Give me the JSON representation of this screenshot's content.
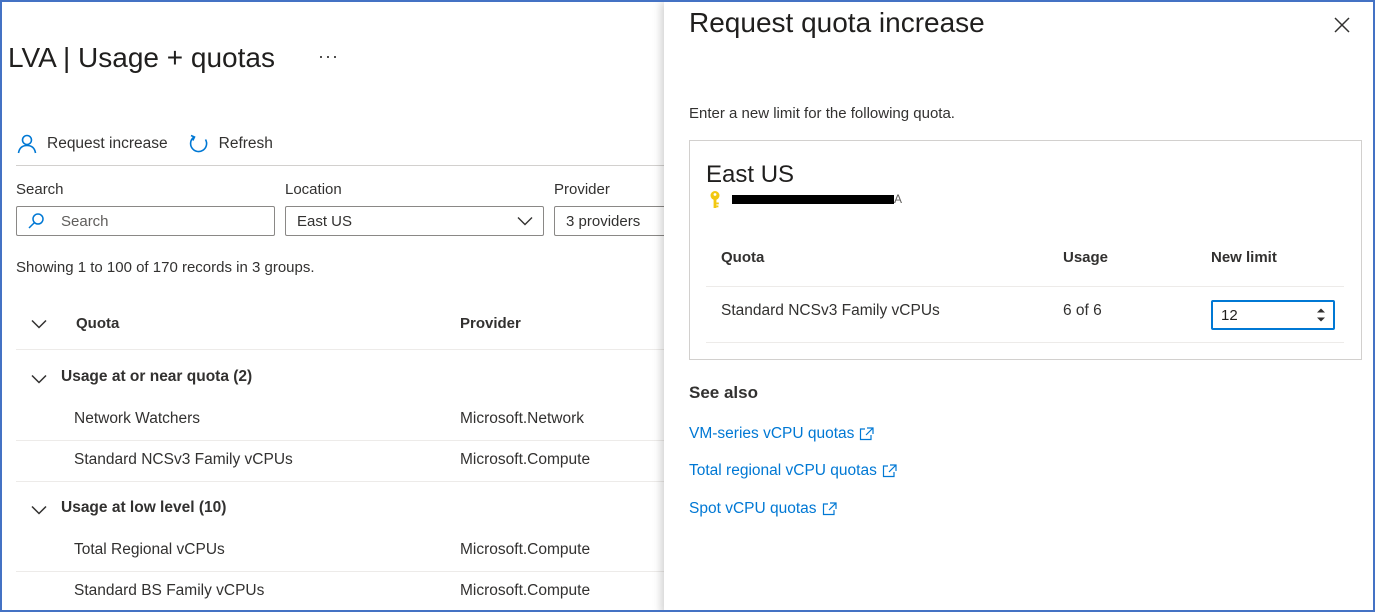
{
  "page": {
    "title": "LVA | Usage + quotas",
    "more_label": "···"
  },
  "toolbar": {
    "request_increase": "Request increase",
    "refresh": "Refresh"
  },
  "filters": {
    "search_label": "Search",
    "search_placeholder": "Search",
    "location_label": "Location",
    "location_value": "East US",
    "provider_label": "Provider",
    "provider_value": "3 providers"
  },
  "summary": "Showing 1 to 100 of 170 records in 3 groups.",
  "grid": {
    "columns": [
      "Quota",
      "Provider"
    ],
    "groups": [
      {
        "label": "Usage at or near quota (2)",
        "rows": [
          {
            "quota": "Network Watchers",
            "provider": "Microsoft.Network"
          },
          {
            "quota": "Standard NCSv3 Family vCPUs",
            "provider": "Microsoft.Compute"
          }
        ]
      },
      {
        "label": "Usage at low level (10)",
        "rows": [
          {
            "quota": "Total Regional vCPUs",
            "provider": "Microsoft.Compute"
          },
          {
            "quota": "Standard BS Family vCPUs",
            "provider": "Microsoft.Compute"
          }
        ]
      }
    ]
  },
  "panel": {
    "title": "Request quota increase",
    "description": "Enter a new limit for the following quota.",
    "card": {
      "region": "East US",
      "subscription_tail": "A",
      "columns": {
        "quota": "Quota",
        "usage": "Usage",
        "new_limit": "New limit"
      },
      "row": {
        "quota": "Standard NCSv3 Family vCPUs",
        "usage": "6 of 6",
        "new_limit": "12"
      }
    },
    "see_also": {
      "heading": "See also",
      "links": [
        "VM-series vCPU quotas",
        "Total regional vCPU quotas",
        "Spot vCPU quotas"
      ]
    }
  },
  "colors": {
    "accent": "#0078d4",
    "frame_border": "#4472c4",
    "key_icon": "#f2c811"
  },
  "icons": {
    "request": "person-icon",
    "refresh": "refresh-icon",
    "search": "search-icon",
    "dropdown": "chevron-down-icon",
    "close": "close-icon",
    "key": "key-icon",
    "external": "external-link-icon"
  }
}
